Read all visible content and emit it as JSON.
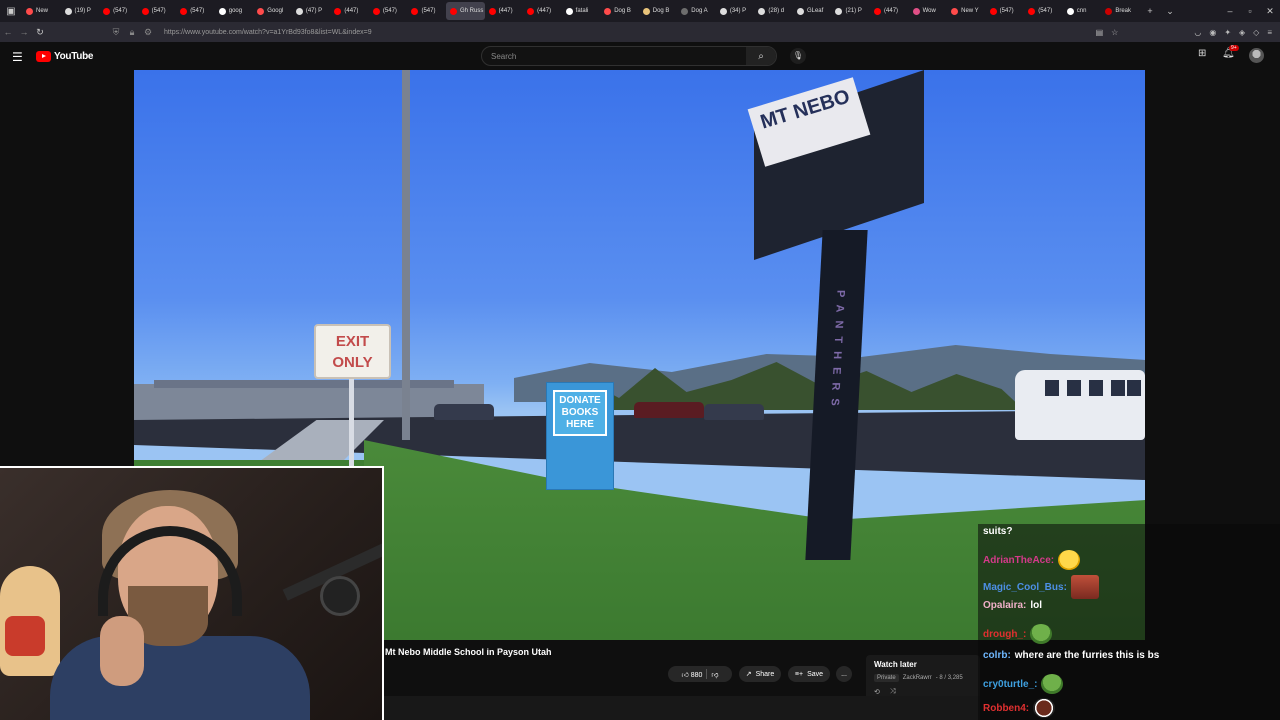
{
  "browser": {
    "tabs": [
      {
        "label": "New",
        "color": "#ff4b4b"
      },
      {
        "label": "(19) P",
        "color": "#dddddd"
      },
      {
        "label": "(547)",
        "color": "#ff0000"
      },
      {
        "label": "(547)",
        "color": "#ff0000"
      },
      {
        "label": "(547)",
        "color": "#ff0000"
      },
      {
        "label": "goog",
        "color": "#ffffff"
      },
      {
        "label": "Googl",
        "color": "#ff4b4b"
      },
      {
        "label": "(47) P",
        "color": "#dddddd"
      },
      {
        "label": "(447)",
        "color": "#ff0000"
      },
      {
        "label": "(547)",
        "color": "#ff0000"
      },
      {
        "label": "(547)",
        "color": "#ff0000"
      },
      {
        "label": "Gh Russ",
        "color": "#ff0000",
        "active": true
      },
      {
        "label": "(447)",
        "color": "#ff0000"
      },
      {
        "label": "(447)",
        "color": "#ff0000"
      },
      {
        "label": "fatali",
        "color": "#ffffff"
      },
      {
        "label": "Dog B",
        "color": "#ff4b4b"
      },
      {
        "label": "Dog B",
        "color": "#e8c37a"
      },
      {
        "label": "Dog A",
        "color": "#6d6d6d"
      },
      {
        "label": "(34) P",
        "color": "#dddddd"
      },
      {
        "label": "(28) d",
        "color": "#dddddd"
      },
      {
        "label": "GLeaf",
        "color": "#dddddd"
      },
      {
        "label": "(21) P",
        "color": "#dddddd"
      },
      {
        "label": "(447)",
        "color": "#ff0000"
      },
      {
        "label": "Wow",
        "color": "#e04f86"
      },
      {
        "label": "New Y",
        "color": "#ff4b4b"
      },
      {
        "label": "(547)",
        "color": "#ff0000"
      },
      {
        "label": "(547)",
        "color": "#ff0000"
      },
      {
        "label": "cnn",
        "color": "#ffffff"
      },
      {
        "label": "Break",
        "color": "#cc0000"
      }
    ],
    "url": "https://www.youtube.com/watch?v=a1YrBd93fo8&list=WL&index=9"
  },
  "header": {
    "logo_text": "YouTube",
    "search_placeholder": "Search",
    "notif_count": "9+"
  },
  "video": {
    "exit_sign": [
      "EXIT",
      "ONLY"
    ],
    "donate_sign": [
      "DONATE",
      "BOOKS",
      "HERE"
    ],
    "school_sign": "MT NEBO",
    "post_text": "PANTHERS"
  },
  "below_video": {
    "title": "Mt Nebo Middle School in Payson Utah",
    "likes": "880",
    "share_label": "Share",
    "save_label": "Save",
    "more_label": "..."
  },
  "watch_later": {
    "title": "Watch later",
    "privacy": "Private",
    "channel": "ZackRawrr",
    "position": "- 8 / 3,285"
  },
  "chat": [
    {
      "user": "",
      "color": "#ffffff",
      "msg": "suits?",
      "emote": ""
    },
    {
      "user": "AdrianTheAce:",
      "color": "#d43a8a",
      "msg": "",
      "emote": "laugh"
    },
    {
      "user": "Magic_Cool_Bus:",
      "color": "#4d8fe6",
      "msg": "",
      "emote": "face"
    },
    {
      "user": "Opalaira:",
      "color": "#f0b0c8",
      "msg": "lol",
      "emote": ""
    },
    {
      "user": "drough_:",
      "color": "#e03030",
      "msg": "",
      "emote": "pepe"
    },
    {
      "user": "colrb:",
      "color": "#6fb8ff",
      "msg": "where are the furries this is bs",
      "emote": ""
    },
    {
      "user": "cry0turtle_:",
      "color": "#3ea0e0",
      "msg": "",
      "emote": "pepe"
    },
    {
      "user": "Robben4:",
      "color": "#e03030",
      "msg": "",
      "emote": "dark"
    }
  ]
}
